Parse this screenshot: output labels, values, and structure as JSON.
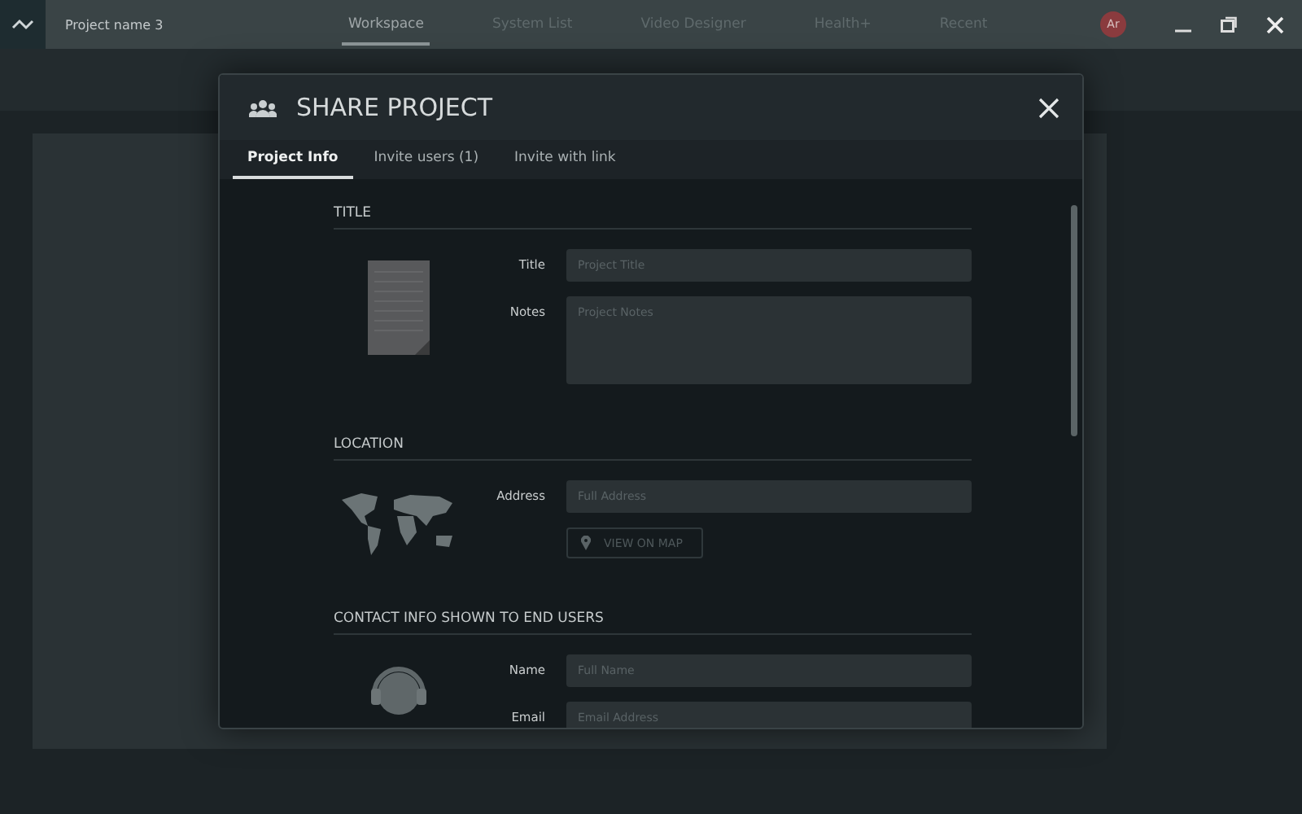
{
  "app_bar": {
    "project": "Project name 3",
    "nav": [
      {
        "label": "Workspace",
        "selected": true
      },
      {
        "label": "System List",
        "selected": false
      },
      {
        "label": "Video Designer",
        "selected": false
      },
      {
        "label": "Health+",
        "selected": false
      },
      {
        "label": "Recent",
        "selected": false
      }
    ],
    "avatar": "Ar"
  },
  "dialog": {
    "title": "SHARE PROJECT",
    "tabs": [
      {
        "label": "Project Info",
        "selected": true
      },
      {
        "label": "Invite users (1)",
        "selected": false
      },
      {
        "label": "Invite with link",
        "selected": false
      }
    ],
    "sections": [
      {
        "kind": "notes",
        "heading": "TITLE",
        "fields": [
          {
            "label": "Title",
            "placeholder": "Project Title",
            "multiline": false
          },
          {
            "label": "Notes",
            "placeholder": "Project Notes",
            "multiline": true
          }
        ]
      },
      {
        "kind": "map",
        "heading": "LOCATION",
        "fields": [
          {
            "label": "Address",
            "placeholder": "Full Address",
            "multiline": false
          }
        ],
        "button": "VIEW ON MAP"
      },
      {
        "kind": "contact",
        "heading": "CONTACT INFO SHOWN TO END USERS",
        "fields": [
          {
            "label": "Name",
            "placeholder": "Full Name",
            "multiline": false
          },
          {
            "label": "Email",
            "placeholder": "Email Address",
            "multiline": false
          }
        ]
      }
    ]
  }
}
